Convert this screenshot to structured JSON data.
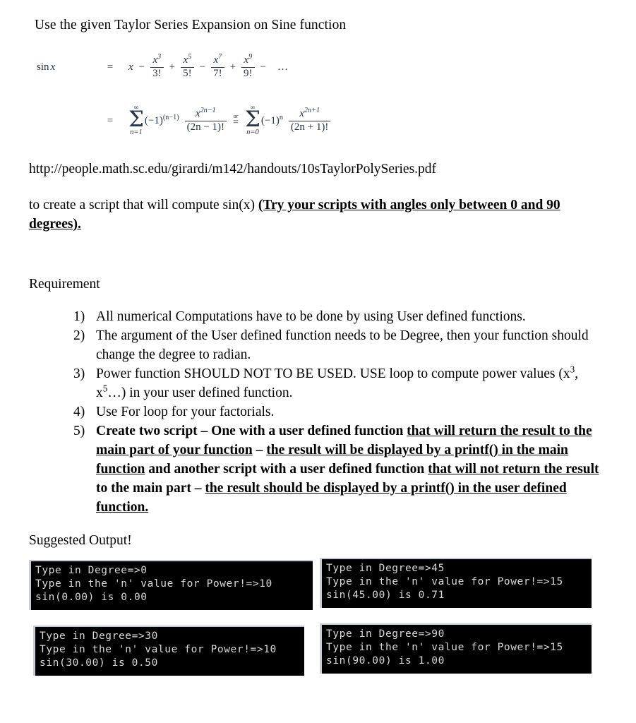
{
  "document": {
    "intro_line": "Use the given Taylor Series Expansion on Sine function",
    "url": "http://people.math.sc.edu/girardi/m142/handouts/10sTaylorPolySeries.pdf",
    "create_script_prefix": "to create a script that will compute sin(x) ",
    "create_script_emphasis": "(Try your scripts with angles only between 0 and 90 degrees).",
    "requirement_heading": "Requirement",
    "suggested_output_heading": "Suggested Output!"
  },
  "formula": {
    "lhs_func": "sin",
    "lhs_var": "x",
    "equals": "=",
    "line1": {
      "first_term": "x",
      "terms": [
        {
          "op": "−",
          "num_base": "x",
          "num_exp": "3",
          "den": "3!"
        },
        {
          "op": "+",
          "num_base": "x",
          "num_exp": "5",
          "den": "5!"
        },
        {
          "op": "−",
          "num_base": "x",
          "num_exp": "7",
          "den": "7!"
        },
        {
          "op": "+",
          "num_base": "x",
          "num_exp": "9",
          "den": "9!"
        }
      ],
      "tail_op": "−",
      "tail": "…"
    },
    "line2": {
      "sum_left": {
        "limit_top": "∞",
        "sigma": "Σ",
        "limit_bottom": "n=1",
        "coefficient": "(−1)",
        "coefficient_exp": "(n−1)",
        "num_base": "x",
        "num_exp": "2n−1",
        "den": "(2n − 1)!"
      },
      "connector_label": "or",
      "connector_symbol": "=",
      "sum_right": {
        "limit_top": "∞",
        "sigma": "Σ",
        "limit_bottom": "n=0",
        "coefficient": "(−1)",
        "coefficient_exp": "n",
        "num_base": "x",
        "num_exp": "2n+1",
        "den": "(2n + 1)!"
      }
    }
  },
  "requirements": [
    {
      "number": "1)",
      "bold": false,
      "text": "All numerical Computations have to be done by using User defined functions."
    },
    {
      "number": "2)",
      "bold": false,
      "text": "The argument of the User defined function needs to be Degree, then your function should change the degree to radian."
    },
    {
      "number": "3)",
      "bold": false,
      "text_parts": [
        {
          "text": "Power function SHOULD NOT TO BE USED. USE loop to compute power values (x",
          "style": "plain"
        },
        {
          "text": "3",
          "style": "sup"
        },
        {
          "text": ", x",
          "style": "plain"
        },
        {
          "text": "5",
          "style": "sup"
        },
        {
          "text": "…) in your user defined function.",
          "style": "plain"
        }
      ],
      "text": "Power function SHOULD NOT TO BE USED. USE loop to compute power values (x3, x5…) in your user defined function."
    },
    {
      "number": "4)",
      "bold": false,
      "text": "Use For loop for your factorials."
    },
    {
      "number": "5)",
      "bold": true,
      "text_parts": [
        {
          "text": "Create two script – One with a user defined function ",
          "style": "plain"
        },
        {
          "text": "that will return the result to the main part of your function",
          "style": "underline"
        },
        {
          "text": " – ",
          "style": "plain"
        },
        {
          "text": "the result will be displayed by a printf() in the main function",
          "style": "underline"
        },
        {
          "text": " and another script with a user defined function ",
          "style": "plain"
        },
        {
          "text": "that will not return the result",
          "style": "underline"
        },
        {
          "text": " to the main part – ",
          "style": "plain"
        },
        {
          "text": "the result should be displayed by a printf() in the user defined function.",
          "style": "underline"
        }
      ],
      "text": "Create two script – One with a user defined function that will return the result to the main part of your function – the result will be displayed by a printf() in the main function and another script with a user defined function that will not return the result to the main part – the result should be displayed by a printf() in the user defined function."
    }
  ],
  "terminals": [
    {
      "id": "terminal-degree-0",
      "lines": [
        "Type in Degree=>0",
        "Type in the 'n' value for Power!=>10",
        "sin(0.00) is 0.00"
      ]
    },
    {
      "id": "terminal-degree-45",
      "lines": [
        "Type in Degree=>45",
        "Type in the 'n' value for Power!=>15",
        "sin(45.00) is 0.71"
      ]
    },
    {
      "id": "terminal-degree-30",
      "lines": [
        "Type in Degree=>30",
        "Type in the 'n' value for Power!=>10",
        "sin(30.00) is 0.50"
      ]
    },
    {
      "id": "terminal-degree-90",
      "lines": [
        "Type in Degree=>90",
        "Type in the 'n' value for Power!=>15",
        "sin(90.00) is 1.00"
      ]
    }
  ],
  "colors": {
    "page_background": "#ffffff",
    "text": "#000000",
    "math_text": "#2b3440",
    "terminal_background": "#000000",
    "terminal_text": "#d8d8d8",
    "terminal_frame": "#c8cdd6"
  }
}
